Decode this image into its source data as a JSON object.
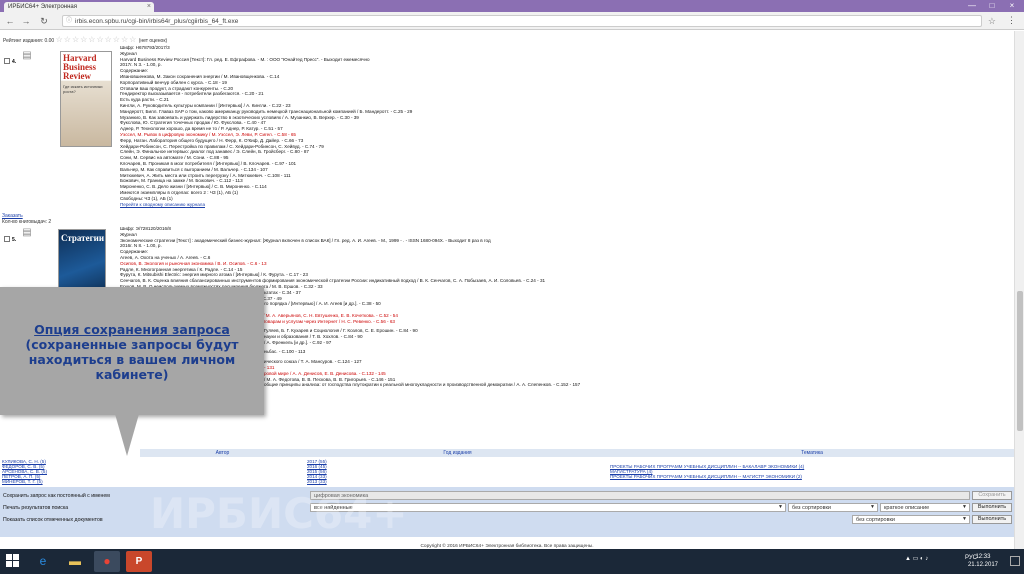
{
  "browser": {
    "tab_title": "ИРБИС64+ Электронная",
    "tab_close": "×",
    "url": "irbis.econ.spbu.ru/cgi-bin/irbis64r_plus/cgiirbis_64_ft.exe",
    "window_controls": [
      "—",
      "□",
      "×"
    ]
  },
  "rating": {
    "label": "Рейтинг издания: 0.00",
    "stars": "☆☆☆☆☆☆☆☆☆☆",
    "votes": "(нет оценок)"
  },
  "records": [
    {
      "number": "4.",
      "cover_title": "Harvard Business Review",
      "cover_sub": "Где искать источники роста?",
      "lines": [
        "Шифр: Н678793/2017/3",
        "Журнал",
        "Harvard Business Review Россия [Текст]: Гл. ред. Е. Ефграфова. - М. : ООО \"Юнайтед Пресс\". - Выходит ежемесячно",
        "2017г. N 3. - 1.00, р.",
        "Содержание:",
        "Ивановшенкова, М. Закон сохранения энергии / М. Ивановщенкова. - С.14",
        "Корпоративный венчур обилен с курса. - С.18 - 19",
        "Отовали ваш продукт, а страдают конкуренты. - С.20",
        "Гендиректор высказывается - потребители разбегаются. - С.20 - 21",
        "Есть куда расти. - С.21",
        "Кингли, А. Руководитель культуры компании / [Интервью] / А. Кингли. - С.22 - 23",
        "Мандеротт, Билл. Главаз SAP о том, каково американцу руководить немецкой транснациональной компанией / Б. Мандеротт. - С.25 - 29",
        "Музанкио, В. Как завоевать и удержать лидерство в экзотических условиях / А. Музанкио, В. Верхер. - С.30 - 39",
        "Фукслова, Ю. Стратегия точечных продаж / Ю. Фукслова. - С.40 - 47",
        "Аднер, Р. Технологии хорошо, да время не то / Р. Аднер, Р. Катур. - С.51 - 57",
        "Уэссел, М. Рывок в цифровую экономику / М. Уэссел, Э. Леви, Р. Сигел. - С.58 - 65",
        "Ферр, Натан. Лаборатория общего будущего / Н. Ферр, К. О'Киф, Д. Дайер. - С.66 - 73",
        "Хейдари-Робинсон, С. Перестройка по правилам / С. Хейдари-Робинсон, С. Хейвуд. - С.74 - 79",
        "Слейн, Э. Финальное интервью: диалог под занавес / Э. Слейн, Б. Гройсберг. - С.80 - 87",
        "Сони, М. Сервис на автомате / М. Сони. - С.88 - 95",
        "Клочарев, В. Проникая в мозг потребителя / [Интервью] / В. Клочарев. - С.97 - 101",
        "Вальчер, М. Как справиться с выгоранием / М. Вальчер. - С.134 - 107",
        "Митюкевич, А. Жить места или строить перегрузку / А. Митюкевич. - С.108 - 111",
        "Божович, М. Граница на замке / М. Божович. - С.112 - 113",
        "Мироненко, С. В. Дело жизни / [Интервью] / С. В. Мироненко. - С.114",
        "Имеются экземпляры в отделах: всего 2 : ЧЗ (1), АБ (1)",
        "Свободны: ЧЗ (1), АБ (1)",
        "Перейти к сводному описанию журнала"
      ],
      "order_link": "Заказать",
      "copies_label": "Кол-во книговыдач: 2"
    },
    {
      "number": "5.",
      "cover_title": "Стратегии",
      "lines": [
        "Шифр: Э/728120/2016/8",
        "Журнал",
        "Экономические стратегии [Текст] : академический бизнес-журнал: [Журнал включен в список ВАК] / Гл. ред. А. И. Агеев. - М., 1999 - . - ISSN 1680-094X. - Выходит 8 раз в год",
        "2016г. N 8. - 1.00, р.",
        "Содержание:",
        "Агеев, А. Охота на ученых / А. Агеев. - С.6",
        "Осипов, В. Экология и рыночная экономика / В. И. Осипов. - С.6 - 13",
        "Радле, К. Многогранная энергетика / К. Радле. - С.14 - 15",
        "Фурута, К. Mitsubishi Electric: энергия мирного атома / [Интервью] / К. Фурута. - С.17 - 23",
        "Сенчагов, В. К. Оценка влияния сбалансированных инструментов формирования экономической стратегии России: индикативный подход / В. К. Сенчагов, С. А. Побызаев, А. И. Соловьев. - С.24 - 31",
        "Ершов, М. В. О неиспользуемых возможностях расширения бюджета / М. В. Ершов. - С.32 - 33",
        "Нисин, Л. Прогноз Сенчагов, В. К. Прогноз о неиспользуемых результатах - С.34 - 37",
        "Леви, Л. Грани закономерности и этичности Интернета / Л. Леви. - С.37 - 49",
        "Агеев, А. И. Институт государственного управления инвестиционного порядка / [Интервью] / А. И. Агеев [и др.]. - С.38 - 50",
        "Другие авторы: Агеев С. В., Новоптинов А. А., Рыков В. А.",
        "Аверьянов, М. А. Цифровая экономика. Трансформация отраслей / М. А. Аверьянов, С. Н. Евтушенко, Е. В. Кочеткова. - С.52 - 54",
        "Ревенко, Н. С. Единый цифровой рынок ЕС: облегчение доступа к товарам и услугам через Интернет / Н. С. Ревенко. - С.56 - 63"
      ],
      "more_lines": [
        "Гуляев, Б. Г. Кухарев и Социология / Г. Козлов, С. Е. Ерошин. - С.84 - 90",
        "науки и образования / Т. В. Хохлов. - С.84 - 90",
        "/ А. Френкель [и др.]. - С.92 - 97",
        "ньбас. - С.100 - 113",
        "ического союза / Т. А. Мансуров. - С.124 - 127",
        "- 131",
        "ровой мире / А. А. Денисов, Е. В. Денисова. - С.132 - 145",
        "/ М. А. Федотова, В. В. Пескова, В. В. Григорьев. - С.146 - 151",
        "общие принципы анализа: от господства плутократии к реальной многоукладности и производственной демократии / А. А. Слепенков. - С.152 - 157"
      ],
      "order_link": "Заказать",
      "copies_label": "Кол-во книговыдач: 2"
    }
  ],
  "callout": {
    "title": "Опция сохранения запроса",
    "body": "(сохраненные запросы будут находиться  в вашем личном кабинете)"
  },
  "facets": {
    "headers": [
      "Автор",
      "Год издания",
      "Тематика"
    ],
    "authors": [
      "КУЛИКОВА, С. Н. (5)",
      "ФЕДОРОВ, С. В. (5)",
      "АРСЕНОВА, С. В. (5)",
      "ПЕТРОВ, А. П. (5)",
      "МИНЕРОВ, Т. Г. (5)"
    ],
    "years": [
      "2017 (55)",
      "2016 (45)",
      "2015 (56)",
      "2014 (33)",
      "2013 (33)"
    ],
    "topics": [
      "ПРОЕКТЫ РАБОЧИХ ПРОГРАММ УЧЕБНЫХ ДИСЦИПЛИН -- БАКАЛАВР ЭКОНОМИКИ (4)",
      "МАГИСТРАТУРА (4)",
      "ПРОЕКТЫ РАБОЧИХ ПРОГРАММ УЧЕБНЫХ ДИСЦИПЛИН -- МАГИСТР ЭКОНОМИКИ (2)"
    ]
  },
  "save_query": {
    "label": "Сохранить запрос как постоянный с именем",
    "value": "цифровая экономика",
    "button": "Сохранить"
  },
  "print_results": {
    "label": "Печать результатов поиска",
    "scope": "все найденные",
    "sort": "без сортировки",
    "format": "краткое описание",
    "button": "Выполнить"
  },
  "show_marked": {
    "label": "Показать список отмеченных документов",
    "sort": "без сортировки",
    "button": "Выполнить"
  },
  "watermark": "ИРБИС64+",
  "footer": "Copyright © 2016 ИРБИС64+ Электронная библиотека. Все права защищены.",
  "taskbar": {
    "lang": "РУС",
    "time": "12:33",
    "date": "21.12.2017"
  }
}
